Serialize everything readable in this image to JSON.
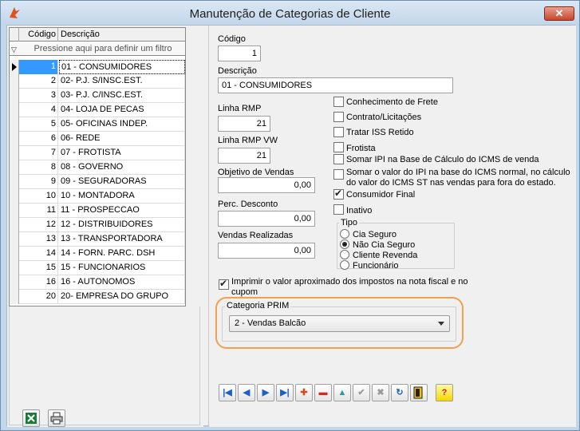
{
  "window": {
    "title": "Manutenção de Categorias de Cliente",
    "close_glyph": "✕"
  },
  "grid": {
    "headers": {
      "code": "Código",
      "desc": "Descrição"
    },
    "filter_text": "Pressione aqui para definir um filtro",
    "rows": [
      {
        "code": "1",
        "desc": "01 - CONSUMIDORES"
      },
      {
        "code": "2",
        "desc": "02- P.J. S/INSC.EST."
      },
      {
        "code": "3",
        "desc": "03- P.J. C/INSC.EST."
      },
      {
        "code": "4",
        "desc": "04- LOJA DE PECAS"
      },
      {
        "code": "5",
        "desc": "05- OFICINAS INDEP."
      },
      {
        "code": "6",
        "desc": "06- REDE"
      },
      {
        "code": "7",
        "desc": "07 - FROTISTA"
      },
      {
        "code": "8",
        "desc": "08 - GOVERNO"
      },
      {
        "code": "9",
        "desc": "09 - SEGURADORAS"
      },
      {
        "code": "10",
        "desc": "10 - MONTADORA"
      },
      {
        "code": "11",
        "desc": "11 - PROSPECCAO"
      },
      {
        "code": "12",
        "desc": "12 - DISTRIBUIDORES"
      },
      {
        "code": "13",
        "desc": "13 - TRANSPORTADORA"
      },
      {
        "code": "14",
        "desc": "14 - FORN. PARC. DSH"
      },
      {
        "code": "15",
        "desc": "15 - FUNCIONARIOS"
      },
      {
        "code": "16",
        "desc": "16 - AUTONOMOS"
      },
      {
        "code": "20",
        "desc": "20- EMPRESA DO GRUPO"
      }
    ]
  },
  "form": {
    "codigo_label": "Código",
    "codigo_value": "1",
    "descricao_label": "Descrição",
    "descricao_value": "01 - CONSUMIDORES",
    "linha_rmp_label": "Linha RMP",
    "linha_rmp_value": "21",
    "linha_rmp_vw_label": "Linha RMP VW",
    "linha_rmp_vw_value": "21",
    "objetivo_label": "Objetivo de Vendas",
    "objetivo_value": "0,00",
    "perc_label": "Perc. Desconto",
    "perc_value": "0,00",
    "vendas_label": "Vendas Realizadas",
    "vendas_value": "0,00",
    "checks": {
      "conhecimento": "Conhecimento de Frete",
      "contrato": "Contrato/Licitações",
      "iss": "Tratar ISS Retido",
      "frotista": "Frotista",
      "somar_ipi": "Somar IPI na Base de Cálculo do ICMS de venda",
      "somar_valor_1": "Somar o valor do IPI na base do ICMS normal, no cálculo",
      "somar_valor_2": "do valor do ICMS ST nas vendas para fora do estado.",
      "consumidor": "Consumidor Final",
      "inativo": "Inativo"
    },
    "tipo": {
      "label": "Tipo",
      "options": [
        "Cia Seguro",
        "Não Cia Seguro",
        "Cliente Revenda",
        "Funcionário"
      ]
    },
    "imprimir_1": "Imprimir o valor aproximado dos impostos na nota fiscal e no",
    "imprimir_2": "cupom",
    "categoria_label": "Categoria PRIM",
    "categoria_value": "2 - Vendas Balcão"
  },
  "colors": {
    "selection": "#3399ff",
    "highlight": "#f0a050"
  }
}
